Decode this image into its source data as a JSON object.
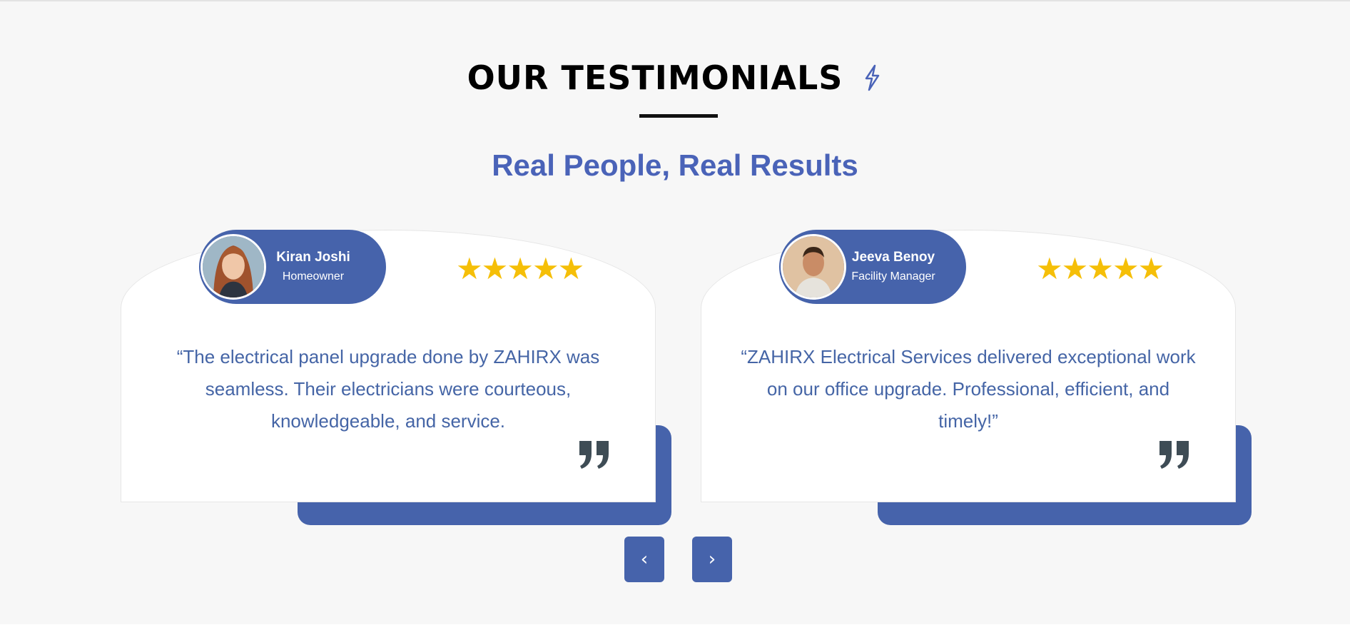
{
  "section": {
    "heading": "OUR TESTIMONIALS",
    "subtitle": "Real People, Real Results"
  },
  "testimonials": [
    {
      "name": "Kiran Joshi",
      "role": "Homeowner",
      "rating": 5,
      "stars": "★★★★★",
      "quote": "“The electrical panel upgrade done by ZAHIRX was seamless. Their electricians were courteous, knowledgeable, and service."
    },
    {
      "name": "Jeeva Benoy",
      "role": "Facility Manager",
      "rating": 5,
      "stars": "★★★★★",
      "quote": "“ZAHIRX Electrical Services delivered exceptional work on our office upgrade. Professional, efficient, and timely!”"
    }
  ],
  "navigation": {
    "prev_label": "‹",
    "next_label": "›"
  },
  "colors": {
    "accent": "#4663ab",
    "subtitle": "#4a63b8",
    "star": "#f5bf08",
    "quote_text": "#4565a6",
    "quote_icon": "#3e4c55"
  }
}
